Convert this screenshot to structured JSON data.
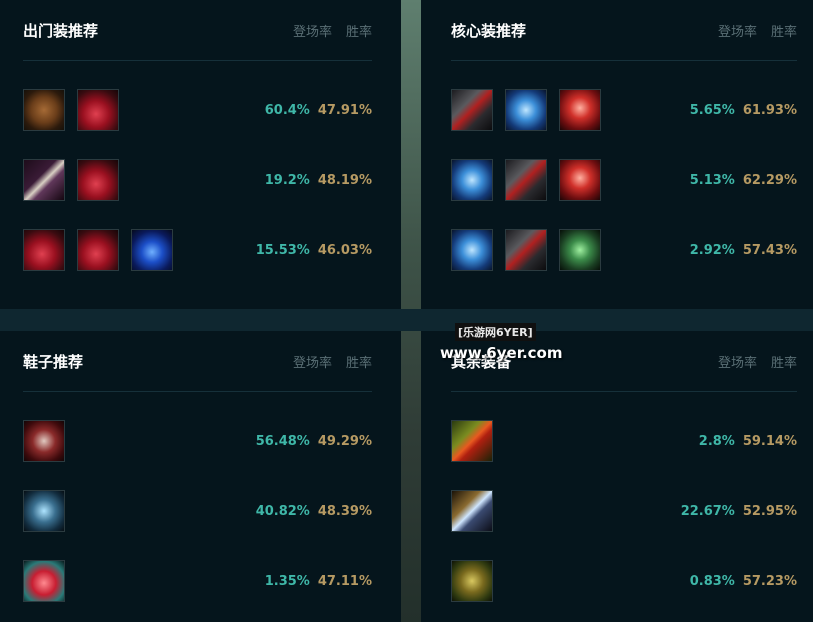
{
  "columns": {
    "pick_rate": "登场率",
    "win_rate": "胜率"
  },
  "panels": [
    {
      "title": "出门装推荐",
      "rows": [
        {
          "items": [
            "wooden-shield-icon",
            "red-potion-icon"
          ],
          "pick_rate": "60.4%",
          "win_rate": "47.91%"
        },
        {
          "items": [
            "dagger-icon",
            "red-potion-icon"
          ],
          "pick_rate": "19.2%",
          "win_rate": "48.19%"
        },
        {
          "items": [
            "red-potion-icon",
            "red-potion-icon",
            "blue-drop-icon"
          ],
          "pick_rate": "15.53%",
          "win_rate": "46.03%"
        }
      ]
    },
    {
      "title": "核心装推荐",
      "rows": [
        {
          "items": [
            "black-axe-icon",
            "ice-gauntlet-icon",
            "red-claw-icon"
          ],
          "pick_rate": "5.65%",
          "win_rate": "61.93%"
        },
        {
          "items": [
            "ice-gauntlet-icon",
            "black-axe-icon",
            "red-claw-icon"
          ],
          "pick_rate": "5.13%",
          "win_rate": "62.29%"
        },
        {
          "items": [
            "ice-gauntlet-icon",
            "black-axe-icon",
            "green-armor-icon"
          ],
          "pick_rate": "2.92%",
          "win_rate": "57.43%"
        }
      ]
    },
    {
      "title": "鞋子推荐",
      "rows": [
        {
          "items": [
            "steel-boots-icon"
          ],
          "pick_rate": "56.48%",
          "win_rate": "49.29%"
        },
        {
          "items": [
            "blue-boots-icon"
          ],
          "pick_rate": "40.82%",
          "win_rate": "48.39%"
        },
        {
          "items": [
            "red-boots-icon"
          ],
          "pick_rate": "1.35%",
          "win_rate": "47.11%"
        }
      ]
    },
    {
      "title": "其余装备",
      "rows": [
        {
          "items": [
            "flame-blade-icon"
          ],
          "pick_rate": "2.8%",
          "win_rate": "59.14%"
        },
        {
          "items": [
            "spear-icon"
          ],
          "pick_rate": "22.67%",
          "win_rate": "52.95%"
        },
        {
          "items": [
            "vine-bow-icon"
          ],
          "pick_rate": "0.83%",
          "win_rate": "57.23%"
        }
      ]
    }
  ],
  "watermark": {
    "line1": "[乐游网6YER]",
    "line2": "www.6yer.com"
  }
}
